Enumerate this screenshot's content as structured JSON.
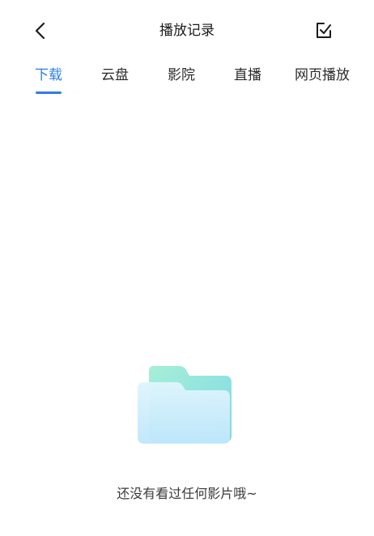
{
  "header": {
    "title": "播放记录",
    "back_icon": "chevron-left-icon",
    "edit_icon": "checkbox-edit-icon"
  },
  "tabs": [
    {
      "label": "下载",
      "active": true
    },
    {
      "label": "云盘",
      "active": false
    },
    {
      "label": "影院",
      "active": false
    },
    {
      "label": "直播",
      "active": false
    },
    {
      "label": "网页播放",
      "active": false
    }
  ],
  "empty_state": {
    "icon": "folder-icon",
    "message": "还没有看过任何影片哦~"
  },
  "colors": {
    "accent": "#2f7ce8",
    "text": "#222222",
    "folder_back": "#8ee6d6",
    "folder_front": "#cdeefc"
  }
}
